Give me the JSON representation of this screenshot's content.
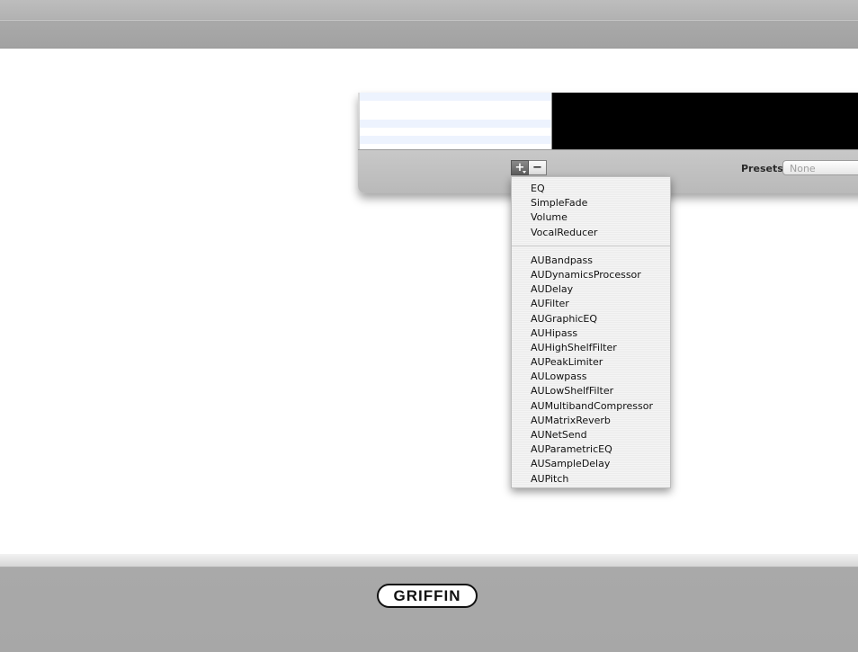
{
  "toolbar": {
    "add_label": "+",
    "remove_label": "−"
  },
  "presets": {
    "label": "Presets:",
    "value": "None"
  },
  "menu": {
    "group1": [
      "EQ",
      "SimpleFade",
      "Volume",
      "VocalReducer"
    ],
    "group2": [
      "AUBandpass",
      "AUDynamicsProcessor",
      "AUDelay",
      "AUFilter",
      "AUGraphicEQ",
      "AUHipass",
      "AUHighShelfFilter",
      "AUPeakLimiter",
      "AULowpass",
      "AULowShelfFilter",
      "AUMultibandCompressor",
      "AUMatrixReverb",
      "AUNetSend",
      "AUParametricEQ",
      "AUSampleDelay",
      "AUPitch"
    ]
  },
  "brand": {
    "logo_text": "GRIFFIN"
  },
  "colors": {
    "bar_gray": "#a9a9a9",
    "list_stripe": "#edf3fe",
    "display_black": "#000000"
  },
  "icons": [
    "add-icon",
    "remove-icon",
    "dropdown-caret-icon"
  ]
}
